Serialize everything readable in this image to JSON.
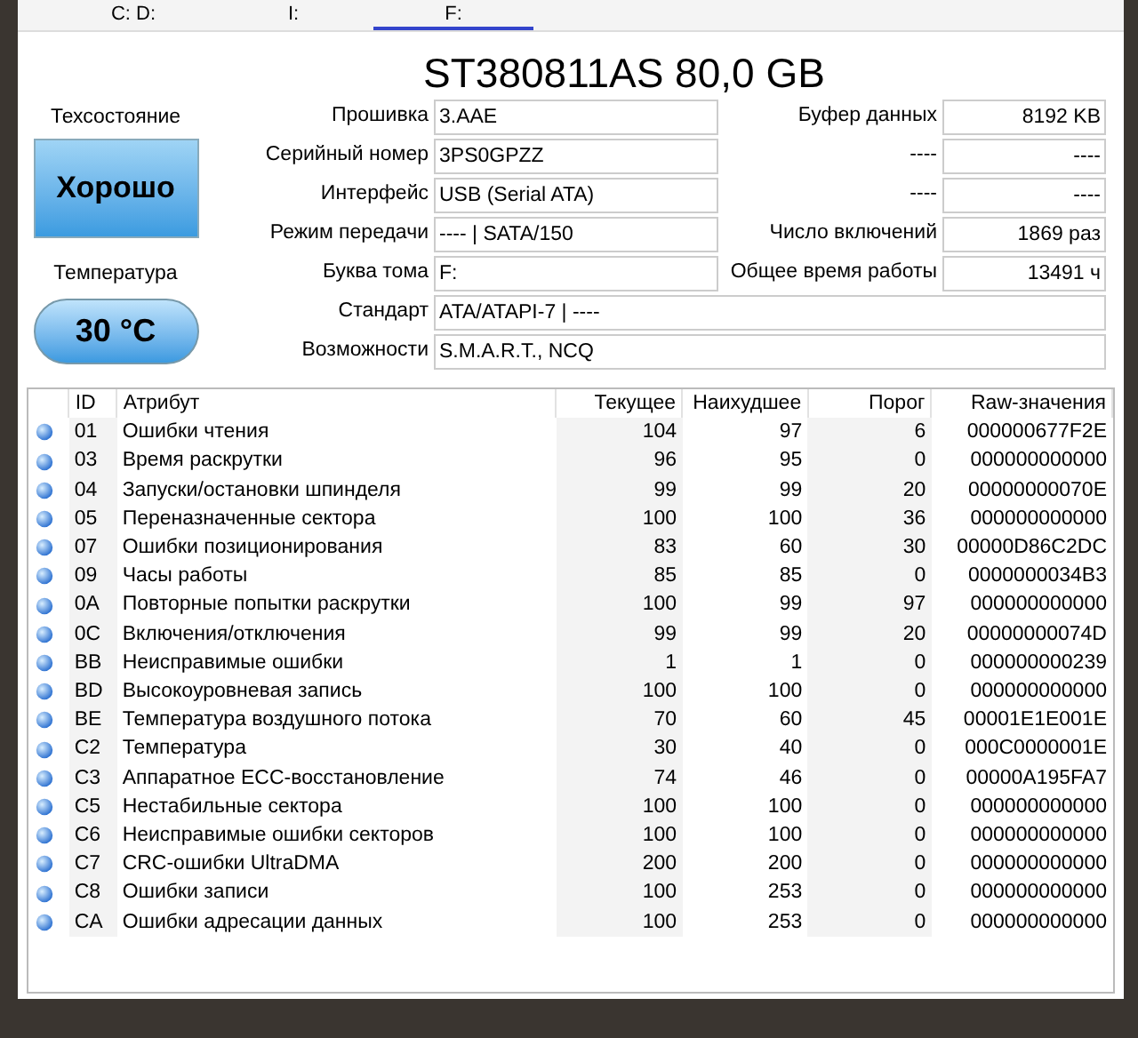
{
  "drive_tabs": [
    {
      "label": "C: D:",
      "selected": false
    },
    {
      "label": "I:",
      "selected": false
    },
    {
      "label": "F:",
      "selected": true
    }
  ],
  "title": "ST380811AS 80,0 GB",
  "health": {
    "label": "Техсостояние",
    "value": "Хорошо"
  },
  "temperature": {
    "label": "Температура",
    "value": "30 °C"
  },
  "info_left": [
    {
      "label": "Прошивка",
      "value": "3.AAE"
    },
    {
      "label": "Серийный номер",
      "value": "3PS0GPZZ"
    },
    {
      "label": "Интерфейс",
      "value": "USB (Serial ATA)"
    },
    {
      "label": "Режим передачи",
      "value": "---- | SATA/150"
    },
    {
      "label": "Буква тома",
      "value": "F:"
    }
  ],
  "info_right": [
    {
      "label": "Буфер данных",
      "value": "8192 KB"
    },
    {
      "label": "----",
      "value": "----"
    },
    {
      "label": "----",
      "value": "----"
    },
    {
      "label": "Число включений",
      "value": "1869 раз"
    },
    {
      "label": "Общее время работы",
      "value": "13491 ч"
    }
  ],
  "info_wide": [
    {
      "label": "Стандарт",
      "value": "ATA/ATAPI-7 | ----"
    },
    {
      "label": "Возможности",
      "value": "S.M.A.R.T., NCQ"
    }
  ],
  "table": {
    "columns": [
      "ID",
      "Атрибут",
      "Текущее",
      "Наихудшее",
      "Порог",
      "Raw-значения"
    ],
    "rows": [
      [
        "01",
        "Ошибки чтения",
        "104",
        "97",
        "6",
        "000000677F2E"
      ],
      [
        "03",
        "Время раскрутки",
        "96",
        "95",
        "0",
        "000000000000"
      ],
      [
        "04",
        "Запуски/остановки шпинделя",
        "99",
        "99",
        "20",
        "00000000070E"
      ],
      [
        "05",
        "Переназначенные сектора",
        "100",
        "100",
        "36",
        "000000000000"
      ],
      [
        "07",
        "Ошибки позиционирования",
        "83",
        "60",
        "30",
        "00000D86C2DC"
      ],
      [
        "09",
        "Часы работы",
        "85",
        "85",
        "0",
        "0000000034B3"
      ],
      [
        "0A",
        "Повторные попытки раскрутки",
        "100",
        "99",
        "97",
        "000000000000"
      ],
      [
        "0C",
        "Включения/отключения",
        "99",
        "99",
        "20",
        "00000000074D"
      ],
      [
        "BB",
        "Неисправимые ошибки",
        "1",
        "1",
        "0",
        "000000000239"
      ],
      [
        "BD",
        "Высокоуровневая запись",
        "100",
        "100",
        "0",
        "000000000000"
      ],
      [
        "BE",
        "Температура воздушного потока",
        "70",
        "60",
        "45",
        "00001E1E001E"
      ],
      [
        "C2",
        "Температура",
        "30",
        "40",
        "0",
        "000C0000001E"
      ],
      [
        "C3",
        "Аппаратное ECC-восстановление",
        "74",
        "46",
        "0",
        "00000A195FA7"
      ],
      [
        "C5",
        "Нестабильные сектора",
        "100",
        "100",
        "0",
        "000000000000"
      ],
      [
        "C6",
        "Неисправимые ошибки секторов",
        "100",
        "100",
        "0",
        "000000000000"
      ],
      [
        "C7",
        "CRC-ошибки UltraDMA",
        "200",
        "200",
        "0",
        "000000000000"
      ],
      [
        "C8",
        "Ошибки записи",
        "100",
        "253",
        "0",
        "000000000000"
      ],
      [
        "CA",
        "Ошибки адресации данных",
        "100",
        "253",
        "0",
        "000000000000"
      ]
    ]
  }
}
